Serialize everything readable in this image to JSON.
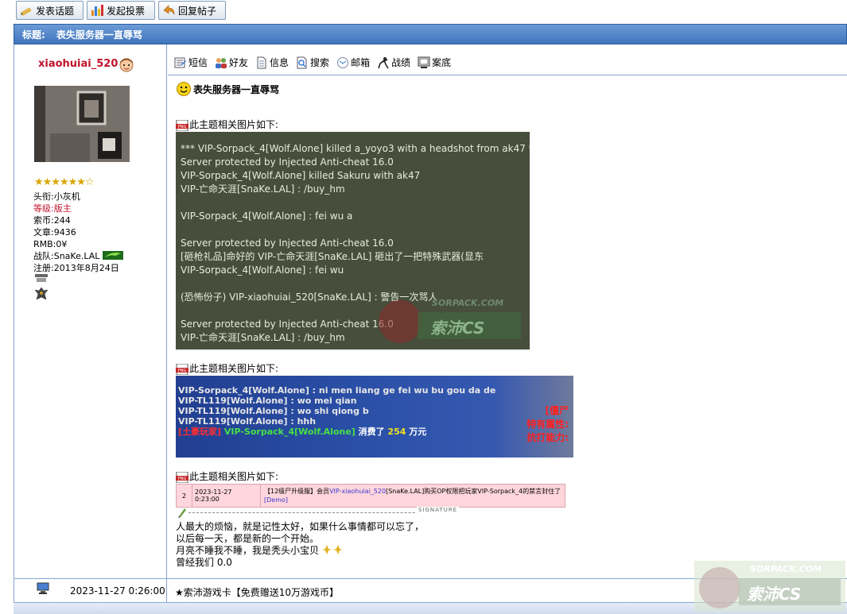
{
  "toolbar": {
    "new_topic": "发表话题",
    "new_poll": "发起投票",
    "reply": "回复帖子"
  },
  "thread": {
    "title_label": "标题:",
    "title": "表失服务器一直辱骂"
  },
  "author": {
    "username": "xiaohuiai_520",
    "stars": "★★★★★★☆",
    "rows": [
      {
        "label": "头衔:",
        "value": "小灰机"
      },
      {
        "label": "等级:",
        "value": "版主"
      },
      {
        "label": "索币:",
        "value": "244"
      },
      {
        "label": "文章:",
        "value": "9436"
      },
      {
        "label": "RMB:",
        "value": "0¥"
      },
      {
        "label": "战队:",
        "value": "SnaKe.LAL"
      },
      {
        "label": "注册:",
        "value": "2013年8月24日"
      }
    ]
  },
  "actions": [
    "短信",
    "好友",
    "信息",
    "搜索",
    "邮箱",
    "战绩",
    "案底"
  ],
  "post": {
    "subject": "表失服务器一直辱骂",
    "image_label": "此主题相关图片如下:",
    "shot1_lines": [
      "*** VIP-Sorpack_4[Wolf.Alone] killed a_yoyo3 with a headshot from ak47 ***",
      "Server protected by Injected Anti-cheat 16.0",
      "VIP-Sorpack_4[Wolf.Alone] killed Sakuru with ak47",
      "VIP-亡命天涯[SnaKe.LAL] : /buy_hm",
      "",
      "VIP-Sorpack_4[Wolf.Alone] : fei wu a",
      "",
      "Server protected by Injected Anti-cheat 16.0",
      "[砸枪礼品]命好的 VIP-亡命天涯[SnaKe.LAL] 砸出了一把特殊武器(显东",
      "VIP-Sorpack_4[Wolf.Alone] : fei wu",
      "",
      "(恐怖份子) VIP-xiaohuiai_520[SnaKe.LAL] : 警告一次骂人",
      "",
      "Server protected by Injected Anti-cheat 16.0",
      "VIP-亡命天涯[SnaKe.LAL] : /buy_hm"
    ],
    "shot1_watermark": "SORPACK.COM",
    "shot1_watermark_cn": "索沛CS",
    "shot2_lines": [
      "VIP-Sorpack_4[Wolf.Alone] : ni men liang ge fei wu bu gou da de",
      "VIP-TL119[Wolf.Alone] : wo mei qian",
      "VIP-TL119[Wolf.Alone] : wo shi qiong b",
      "VIP-TL119[Wolf.Alone] : hhh"
    ],
    "shot2_last": {
      "prefix": "[土豪玩家]",
      "name": " VIP-Sorpack_4[Wolf.Alone] ",
      "mid": "消费了 ",
      "amount": "254",
      "suffix": " 万元"
    },
    "shot2_side": [
      "[僵尸",
      "特有属性:",
      "抗打能力:"
    ],
    "shot3": {
      "num": "2",
      "time": "2023-11-27 0:23:00",
      "text_a": "【12级尸升级服】会员",
      "text_link": "VIP-xiaohuiai_520",
      "text_b": "[SnaKe.LAL]购买OP权限把玩家VIP-Sorpack_4的禁言封住了",
      "demo": "[Demo]"
    },
    "signature_label": "SIGNATURE",
    "signature_lines": [
      "人最大的烦恼，就是记性太好，如果什么事情都可以忘了，",
      "以后每一天，都是新的一个开始。",
      "月亮不睡我不睡，我是秃头小宝贝",
      "曾经我们  0.0"
    ]
  },
  "footer": {
    "time": "2023-11-27 0:26:00",
    "ad": "★索沛游戏卡【免费赠送10万游戏币】"
  },
  "watermark": {
    "en": "SORPACK.COM",
    "cn": "索沛CS"
  },
  "colors": {
    "title_bar": "#3f74bd",
    "username": "#c0142b",
    "border": "#86a6d0"
  }
}
